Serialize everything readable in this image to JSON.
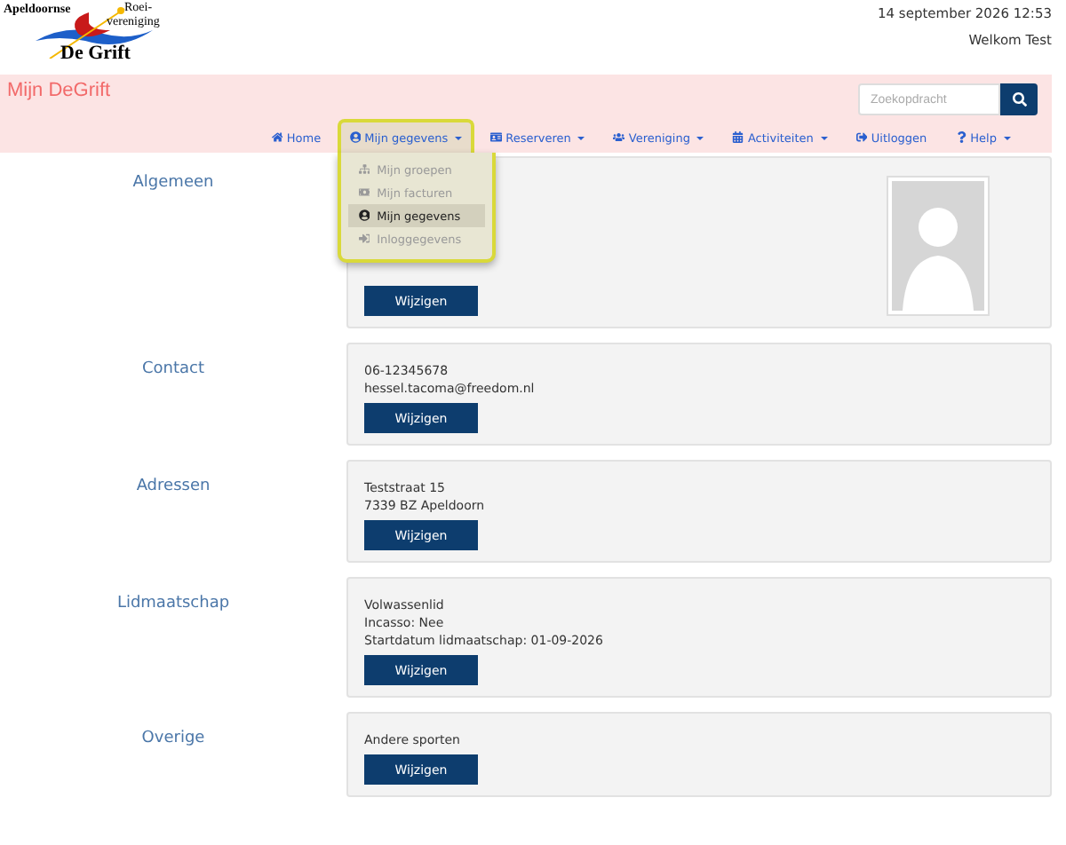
{
  "logo": {
    "line_1": "Apeldoornse",
    "line_2": "Roei-",
    "line_3": "vereniging",
    "line_4": "De Grift"
  },
  "header": {
    "datetime": "14 september 2026 12:53",
    "welcome": "Welkom Test"
  },
  "banner": {
    "title": "Mijn DeGrift",
    "search": {
      "placeholder": "Zoekopdracht"
    }
  },
  "nav": [
    {
      "kind": "home",
      "label": "Home",
      "caret": false,
      "open": false
    },
    {
      "kind": "user",
      "label": "Mijn gegevens",
      "caret": true,
      "open": true
    },
    {
      "kind": "card",
      "label": "Reserveren",
      "caret": true,
      "open": false
    },
    {
      "kind": "group",
      "label": "Vereniging",
      "caret": true,
      "open": false
    },
    {
      "kind": "calendar",
      "label": "Activiteiten",
      "caret": true,
      "open": false
    },
    {
      "kind": "logout",
      "label": "Uitloggen",
      "caret": false,
      "open": false
    },
    {
      "kind": "help",
      "label": "Help",
      "caret": true,
      "open": false
    }
  ],
  "dropdown": [
    {
      "kind": "groups",
      "label": "Mijn groepen",
      "selected": false
    },
    {
      "kind": "invoice",
      "label": "Mijn facturen",
      "selected": false
    },
    {
      "kind": "user",
      "label": "Mijn gegevens",
      "selected": true
    },
    {
      "kind": "login",
      "label": "Inloggegevens",
      "selected": false
    }
  ],
  "sections": [
    {
      "title": "Algemeen",
      "photo": true,
      "button": "Wijzigen"
    },
    {
      "title": "Contact",
      "lines": [
        "06-12345678",
        "hessel.tacoma@freedom.nl"
      ],
      "photo": false,
      "button": "Wijzigen"
    },
    {
      "title": "Adressen",
      "lines": [
        "Teststraat 15",
        "7339 BZ Apeldoorn"
      ],
      "photo": false,
      "button": "Wijzigen"
    },
    {
      "title": "Lidmaatschap",
      "lines": [
        "Volwassenlid",
        "Incasso: Nee",
        "Startdatum lidmaatschap: 01-09-2026"
      ],
      "photo": false,
      "button": "Wijzigen"
    },
    {
      "title": "Overige",
      "lines": [
        "Andere sporten"
      ],
      "photo": false,
      "button": "Wijzigen"
    }
  ]
}
